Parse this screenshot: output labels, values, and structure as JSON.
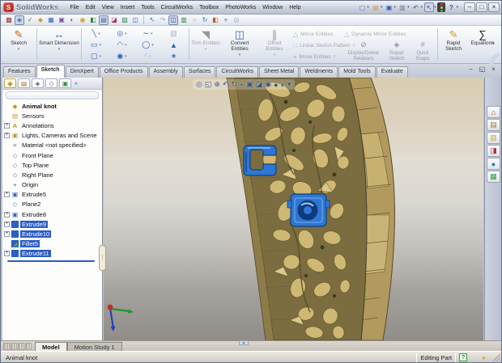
{
  "title_bar": {
    "logo_glyph": "S",
    "app_name": "SolidWorks",
    "menus": [
      "File",
      "Edit",
      "View",
      "Insert",
      "Tools",
      "CircuitWorks",
      "Toolbox",
      "PhotoWorks",
      "Window",
      "Help"
    ],
    "quick_access": [
      {
        "name": "new-document",
        "glyph": "▢"
      },
      {
        "name": "open-document",
        "glyph": "▤"
      },
      {
        "name": "save",
        "glyph": "▣"
      },
      {
        "name": "print",
        "glyph": "▥"
      },
      {
        "name": "undo",
        "glyph": "↶"
      },
      {
        "name": "select",
        "glyph": "↖"
      }
    ],
    "help_glyph": "?",
    "minimize_glyph": "–",
    "maximize_glyph": "□",
    "close_glyph": "×"
  },
  "standard_toolbar": {
    "group1": [
      "▩",
      "◈",
      "✓",
      "◆",
      "▦",
      "▣",
      "◐",
      "◉",
      "◧",
      "▤",
      "◪",
      "▨",
      "◫"
    ],
    "group2": [
      "↖",
      "↷",
      "◫",
      "▥",
      "○",
      "↻",
      "◧",
      "+",
      "◎"
    ]
  },
  "sketch_toolbar": {
    "sketch": {
      "label": "Sketch",
      "glyph": "✎"
    },
    "smart_dimension": {
      "label": "Smart Dimension",
      "glyph": "↔"
    },
    "entity_tools": [
      {
        "name": "line-tool",
        "glyph": "╲"
      },
      {
        "name": "circle-tool",
        "glyph": "◎"
      },
      {
        "name": "spline-tool",
        "glyph": "∼"
      },
      {
        "name": "sketch-picture-tool",
        "glyph": "▧"
      },
      {
        "name": "rectangle-tool",
        "glyph": "▭"
      },
      {
        "name": "arc-tool",
        "glyph": "◠"
      },
      {
        "name": "ellipse-tool",
        "glyph": "◯"
      },
      {
        "name": "text-tool",
        "glyph": "▲"
      },
      {
        "name": "slot-tool",
        "glyph": "▢"
      },
      {
        "name": "point-tool",
        "glyph": "◉"
      },
      {
        "name": "fillet-tool",
        "glyph": "◜"
      },
      {
        "name": "star-tool",
        "glyph": "∗"
      }
    ],
    "trim": {
      "label": "Trim Entities",
      "glyph": "◥"
    },
    "convert": {
      "label": "Convert Entities",
      "glyph": "◫"
    },
    "offset": {
      "label": "Offset Entities",
      "glyph": "∥"
    },
    "mirror": {
      "label": "Mirror Entities",
      "glyph": "△"
    },
    "linear_pattern": {
      "label": "Linear Sketch Pattern",
      "glyph": "∷"
    },
    "move": {
      "label": "Move Entities",
      "glyph": "+"
    },
    "dynamic_mirror": {
      "label": "Dynamic Mirror Entities",
      "glyph": "△"
    },
    "display_delete": {
      "label": "Display/Delete\nRelations",
      "glyph": "⊘"
    },
    "repair": {
      "label": "Repair\nSketch",
      "glyph": "◈"
    },
    "quick_snaps": {
      "label": "Quick\nSnaps",
      "glyph": "#"
    },
    "rapid_sketch": {
      "label": "Rapid\nSketch",
      "glyph": "✎"
    },
    "equations": {
      "label": "Equations",
      "glyph": "∑"
    },
    "overflow_glyph": "»"
  },
  "command_tabs": [
    {
      "label": "Features",
      "active": false
    },
    {
      "label": "Sketch",
      "active": true
    },
    {
      "label": "DimXpert",
      "active": false
    },
    {
      "label": "Office Products",
      "active": false
    },
    {
      "label": "Assembly",
      "active": false
    },
    {
      "label": "Surfaces",
      "active": false
    },
    {
      "label": "CircuitWorks",
      "active": false
    },
    {
      "label": "Sheet Metal",
      "active": false
    },
    {
      "label": "Weldments",
      "active": false
    },
    {
      "label": "Mold Tools",
      "active": false
    },
    {
      "label": "Evaluate",
      "active": false
    }
  ],
  "document_controls": {
    "minimize": "–",
    "restore": "◱",
    "close": "×"
  },
  "feature_tree": {
    "panel_tabs": [
      {
        "name": "featuremanager-tab",
        "glyph": "◆"
      },
      {
        "name": "propertymanager-tab",
        "glyph": "▤"
      },
      {
        "name": "configurationmanager-tab",
        "glyph": "◈"
      },
      {
        "name": "dimxpertmanager-tab",
        "glyph": "◇"
      },
      {
        "name": "displaymanager-tab",
        "glyph": "▣"
      }
    ],
    "overflow_glyph": "»",
    "items": [
      {
        "label": "Animal knot",
        "glyph": "◆",
        "expand": "",
        "selected": false
      },
      {
        "label": "Sensors",
        "glyph": "▤",
        "expand": "",
        "selected": false
      },
      {
        "label": "Annotations",
        "glyph": "A",
        "expand": "+",
        "selected": false
      },
      {
        "label": "Lights, Cameras and Scene",
        "glyph": "▣",
        "expand": "+",
        "selected": false
      },
      {
        "label": "Material <not specified>",
        "glyph": "≡",
        "expand": "",
        "selected": false
      },
      {
        "label": "Front Plane",
        "glyph": "◇",
        "expand": "",
        "selected": false
      },
      {
        "label": "Top Plane",
        "glyph": "◇",
        "expand": "",
        "selected": false
      },
      {
        "label": "Right Plane",
        "glyph": "◇",
        "expand": "",
        "selected": false
      },
      {
        "label": "Origin",
        "glyph": "+",
        "expand": "",
        "selected": false
      },
      {
        "label": "Extrude5",
        "glyph": "▣",
        "expand": "+",
        "selected": false
      },
      {
        "label": "Plane2",
        "glyph": "◇",
        "expand": "",
        "selected": false
      },
      {
        "label": "Extrude8",
        "glyph": "▣",
        "expand": "+",
        "selected": false
      },
      {
        "label": "Extrude9",
        "glyph": "▣",
        "expand": "+",
        "selected": true
      },
      {
        "label": "Extrude10",
        "glyph": "▣",
        "expand": "+",
        "selected": true
      },
      {
        "label": "Fillet5",
        "glyph": "◢",
        "expand": "",
        "selected": true
      },
      {
        "label": "Extrude11",
        "glyph": "▣",
        "expand": "+",
        "selected": true
      }
    ]
  },
  "viewport": {
    "hud_icons": [
      {
        "name": "zoom-to-fit",
        "glyph": "◎"
      },
      {
        "name": "zoom-to-area",
        "glyph": "◱"
      },
      {
        "name": "zoom-in-out",
        "glyph": "⊕"
      },
      {
        "name": "previous-view",
        "glyph": "↶"
      },
      {
        "name": "rotate-view",
        "glyph": "↻"
      },
      {
        "name": "pan",
        "glyph": "+"
      },
      {
        "name": "view-orientation",
        "glyph": "▣"
      },
      {
        "name": "display-style",
        "glyph": "◪"
      },
      {
        "name": "hide-show-items",
        "glyph": "◉"
      },
      {
        "name": "edit-appearance",
        "glyph": "●"
      },
      {
        "name": "apply-scene",
        "glyph": "◐"
      },
      {
        "name": "view-settings",
        "glyph": "▾"
      }
    ],
    "model_colors": {
      "panel": "#7b6d3f",
      "holes": "#cfb873",
      "rail": "#b29a5f",
      "selection": "#2e77d2"
    }
  },
  "task_pane": [
    {
      "name": "solidworks-resources-tab",
      "glyph": "⌂"
    },
    {
      "name": "design-library-tab",
      "glyph": "▤"
    },
    {
      "name": "file-explorer-tab",
      "glyph": "▥"
    },
    {
      "name": "view-palette-tab",
      "glyph": "◨"
    },
    {
      "name": "appearances-scenes-tab",
      "glyph": "●"
    },
    {
      "name": "custom-properties-tab",
      "glyph": "▦"
    }
  ],
  "bottom_bar": {
    "tabs": [
      {
        "label": "Model",
        "active": true
      },
      {
        "label": "Motion Study 1",
        "active": false
      }
    ]
  },
  "status_bar": {
    "left_text": "Animal knot",
    "mode_text": "Editing Part",
    "help_glyph": "?",
    "badge_glyph": "●"
  }
}
